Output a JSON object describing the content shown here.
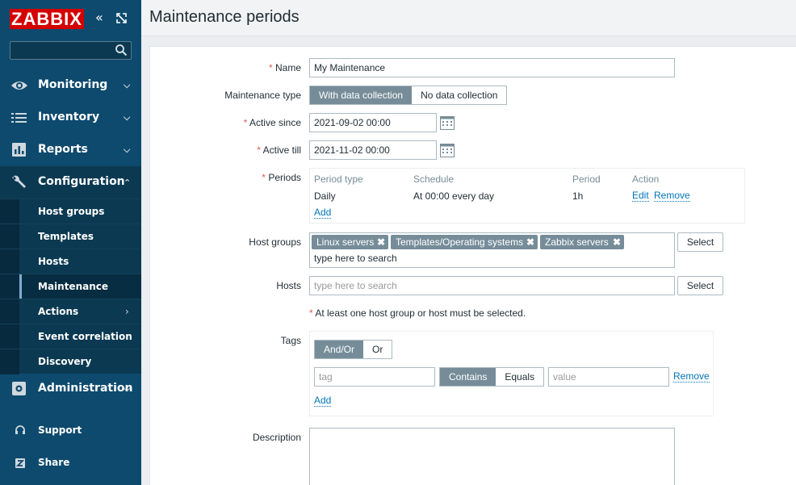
{
  "sidebar": {
    "logo": "ZABBIX",
    "collapse_glyph": "«",
    "kiosk_glyph": "⤢",
    "search_placeholder": "",
    "menu": [
      {
        "label": "Monitoring",
        "icon": "eye-icon"
      },
      {
        "label": "Inventory",
        "icon": "list-icon"
      },
      {
        "label": "Reports",
        "icon": "bar-chart-icon"
      },
      {
        "label": "Configuration",
        "icon": "wrench-icon"
      },
      {
        "label": "Administration",
        "icon": "gear-icon"
      }
    ],
    "config_sub": [
      "Host groups",
      "Templates",
      "Hosts",
      "Maintenance",
      "Actions",
      "Event correlation",
      "Discovery"
    ],
    "active_sub": "Maintenance",
    "bottom": [
      {
        "label": "Support",
        "icon": "headset-icon"
      },
      {
        "label": "Share",
        "icon": "share-icon"
      }
    ]
  },
  "header": {
    "title": "Maintenance periods"
  },
  "form": {
    "name_label": "Name",
    "name_value": "My Maintenance",
    "type_label": "Maintenance type",
    "type_options": [
      "With data collection",
      "No data collection"
    ],
    "type_selected": "With data collection",
    "since_label": "Active since",
    "since_value": "2021-09-02 00:00",
    "till_label": "Active till",
    "till_value": "2021-11-02 00:00",
    "periods_label": "Periods",
    "periods_columns": [
      "Period type",
      "Schedule",
      "Period",
      "Action"
    ],
    "periods_rows": [
      {
        "type": "Daily",
        "schedule": "At 00:00 every day",
        "period": "1h",
        "edit": "Edit",
        "remove": "Remove"
      }
    ],
    "periods_add": "Add",
    "hostgroups_label": "Host groups",
    "hostgroups": [
      "Linux servers",
      "Templates/Operating systems",
      "Zabbix servers"
    ],
    "hostgroups_placeholder": "type here to search",
    "hosts_label": "Hosts",
    "hosts_placeholder": "type here to search",
    "select_label": "Select",
    "hint": "At least one host group or host must be selected.",
    "tags_label": "Tags",
    "tags_eval": [
      "And/Or",
      "Or"
    ],
    "tag_placeholder": "tag",
    "tag_ops": [
      "Contains",
      "Equals"
    ],
    "value_placeholder": "value",
    "tag_remove": "Remove",
    "tag_add": "Add",
    "description_label": "Description",
    "required_mark": "*",
    "remove_glyph": "✖"
  }
}
